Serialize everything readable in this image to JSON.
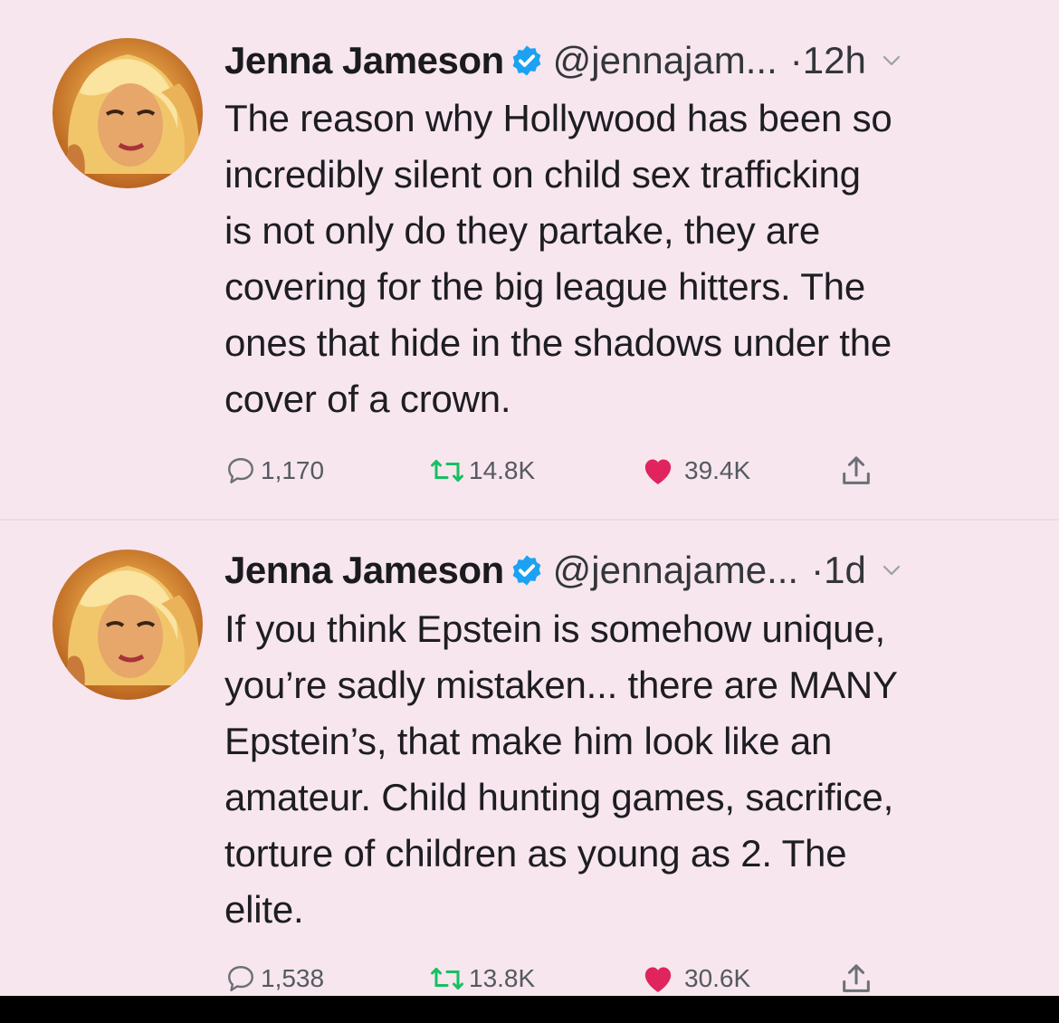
{
  "tweets": [
    {
      "name": "Jenna Jameson",
      "handle": "@jennajam...",
      "time": "·12h",
      "lines": [
        "The reason why Hollywood has been so",
        "incredibly silent on child sex trafficking",
        "is not only do they partake, they are",
        "covering for the big league hitters. The",
        "ones that hide in the shadows under the",
        "cover of a crown."
      ],
      "replies": "1,170",
      "retweets": "14.8K",
      "likes": "39.4K"
    },
    {
      "name": "Jenna Jameson",
      "handle": "@jennajame...",
      "time": "·1d",
      "lines": [
        "If you think Epstein is somehow unique,",
        "you’re sadly mistaken... there are MANY",
        "Epstein’s, that make him look like an",
        "amateur. Child hunting games, sacrifice,",
        "torture of children as young as 2. The",
        "elite."
      ],
      "replies": "1,538",
      "retweets": "13.8K",
      "likes": "30.6K"
    }
  ],
  "colors": {
    "background": "#f7e6ee",
    "verified": "#1da1f2",
    "like": "#e0245e",
    "retweet": "#17bf63",
    "text": "#1d1d22",
    "meta": "#555a60"
  },
  "icons": [
    "verified-badge-icon",
    "chevron-down-icon",
    "reply-icon",
    "retweet-icon",
    "like-heart-icon",
    "share-icon"
  ]
}
